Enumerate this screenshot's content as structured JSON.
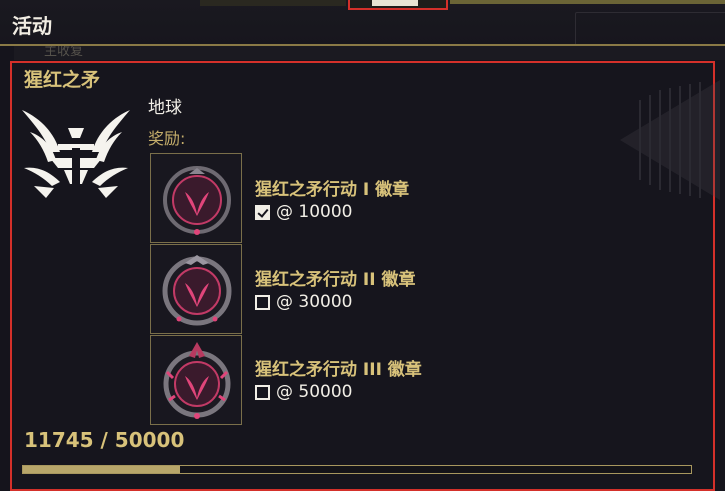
{
  "header": {
    "title": "活动"
  },
  "subheader": {
    "ghost_label": "主收复"
  },
  "event": {
    "title": "猩红之矛",
    "planet": "地球",
    "rewards_label": "奖励:",
    "rewards": [
      {
        "name": "猩红之矛行动 I 徽章",
        "requirement": "@ 10000",
        "completed": true
      },
      {
        "name": "猩红之矛行动 II 徽章",
        "requirement": "@ 30000",
        "completed": false
      },
      {
        "name": "猩红之矛行动 III 徽章",
        "requirement": "@ 50000",
        "completed": false
      }
    ],
    "progress": {
      "text": "11745 / 50000",
      "current": 11745,
      "max": 50000
    }
  },
  "colors": {
    "gold": "#d8c27a",
    "highlight": "#d4302a",
    "badge_accent": "#e0457a"
  }
}
